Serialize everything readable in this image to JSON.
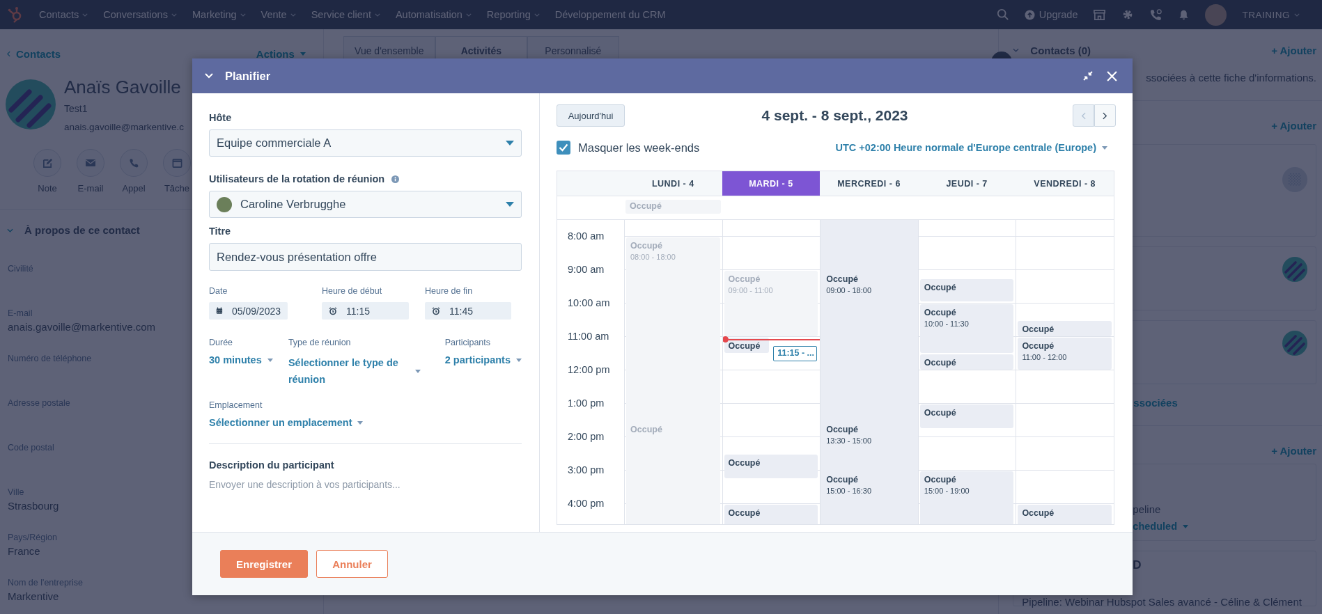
{
  "nav": {
    "items": [
      {
        "label": "Contacts",
        "has_menu": true
      },
      {
        "label": "Conversations",
        "has_menu": true
      },
      {
        "label": "Marketing",
        "has_menu": true
      },
      {
        "label": "Vente",
        "has_menu": true
      },
      {
        "label": "Service client",
        "has_menu": true
      },
      {
        "label": "Automatisation",
        "has_menu": true
      },
      {
        "label": "Reporting",
        "has_menu": true
      },
      {
        "label": "Développement du CRM",
        "has_menu": false
      }
    ],
    "upgrade": "Upgrade",
    "account": "TRAINING"
  },
  "record": {
    "back": "Contacts",
    "actions": "Actions",
    "name": "Anaïs Gavoille",
    "subtitle": "Test1",
    "email": "anais.gavoille@markentive.c",
    "quick_actions": [
      {
        "label": "Note",
        "kind": "note"
      },
      {
        "label": "E-mail",
        "kind": "email"
      },
      {
        "label": "Appel",
        "kind": "call"
      },
      {
        "label": "Tâche",
        "kind": "task"
      }
    ],
    "about": {
      "title": "À propos de ce contact",
      "expanded": true,
      "fields": [
        {
          "label": "Civilité"
        },
        {
          "label": "E-mail",
          "value": "anais.gavoille@markentive.com"
        },
        {
          "label": "Numéro de téléphone"
        },
        {
          "label": "Adresse postale"
        },
        {
          "label": "Code postal"
        },
        {
          "label": "Ville",
          "value": "Strasbourg"
        },
        {
          "label": "Pays/Région",
          "value": "France"
        },
        {
          "label": "Nom de l'entreprise",
          "value": "Markentive"
        }
      ]
    }
  },
  "center": {
    "tabs": [
      {
        "label": "Vue d'ensemble",
        "selected": false
      },
      {
        "label": "Activités",
        "selected": true
      },
      {
        "label": "Personnalisé",
        "selected": false
      }
    ]
  },
  "sidebar": {
    "sections": [
      {
        "title": "Contacts (0)",
        "expanded": true,
        "action": "+ Ajouter",
        "text": "ssociées à cette fiche d'informations."
      },
      {
        "action": "+ Ajouter",
        "cards": [
          {
            "kind": "placeholder"
          },
          {
            "kind": "avatar"
          },
          {
            "kind": "avatar"
          }
        ],
        "link": "ssociées"
      },
      {
        "action": "+ Ajouter",
        "cards": [
          {
            "kind": "text",
            "lines": [
              {
                "text": "peline",
                "kind": "plain"
              },
              {
                "text": "cheduled",
                "kind": "dropdown"
              }
            ]
          },
          {
            "kind": "text",
            "lines": [
              {
                "text": "D",
                "kind": "heading"
              },
              {
                "text": "Pipeline:  Webinar Hubspot Sales avancé - Céline & Clément",
                "kind": "full"
              }
            ]
          }
        ]
      }
    ]
  },
  "dialog": {
    "title": "Planifier",
    "expanded": true,
    "form": {
      "host": {
        "label": "Hôte",
        "value": "Equipe commerciale A"
      },
      "rotation": {
        "label": "Utilisateurs de la rotation de réunion",
        "value": "Caroline Verbrugghe"
      },
      "title": {
        "label": "Titre",
        "value": "Rendez-vous présentation offre"
      },
      "date": {
        "label": "Date",
        "value": "05/09/2023"
      },
      "start": {
        "label": "Heure de début",
        "value": "11:15"
      },
      "end": {
        "label": "Heure de fin",
        "value": "11:45"
      },
      "duration": {
        "label": "Durée",
        "value": "30 minutes"
      },
      "meeting_type": {
        "label": "Type de réunion",
        "value": "Sélectionner le type de réunion"
      },
      "participants": {
        "label": "Participants",
        "value": "2 participants"
      },
      "location": {
        "label": "Emplacement",
        "value": "Sélectionner un emplacement"
      },
      "description": {
        "label": "Description du participant",
        "placeholder": "Envoyer une description à vos participants..."
      }
    },
    "buttons": [
      {
        "label": "Enregistrer",
        "kind": "primary"
      },
      {
        "label": "Annuler",
        "kind": "secondary"
      }
    ],
    "calendar": {
      "today": "Aujourd'hui",
      "range": "4 sept. - 8 sept., 2023",
      "hide_weekends": {
        "label": "Masquer les week-ends",
        "checked": true
      },
      "timezone": "UTC +02:00 Heure normale d'Europe centrale (Europe)",
      "hours": [
        "8:00 am",
        "9:00 am",
        "10:00 am",
        "11:00 am",
        "12:00 pm",
        "1:00 pm",
        "2:00 pm",
        "3:00 pm",
        "4:00 pm"
      ],
      "draft": {
        "label": "11:15 - ..."
      },
      "days": [
        {
          "label": "LUNDI - 4",
          "selected": false,
          "shaded": false,
          "all_day": {
            "title": "Occupé",
            "past": true
          },
          "events": [
            {
              "title": "Occupé",
              "time": "08:00 - 18:00",
              "past": true
            },
            {
              "title": "Occupé",
              "past": true
            }
          ]
        },
        {
          "label": "MARDI - 5",
          "selected": true,
          "shaded": false,
          "events": [
            {
              "title": "Occupé",
              "time": "09:00 - 11:00",
              "past": true
            },
            {
              "title": "Occupé",
              "past": false
            },
            {
              "title": "Occupé",
              "past": false
            },
            {
              "title": "Occupé",
              "past": false
            }
          ]
        },
        {
          "label": "MERCREDI - 6",
          "selected": false,
          "shaded": true,
          "events": [
            {
              "title": "Occupé",
              "time": "09:00 - 18:00",
              "past": false
            },
            {
              "title": "Occupé",
              "time": "13:30 - 15:00",
              "past": false
            },
            {
              "title": "Occupé",
              "time": "15:00 - 16:30",
              "past": false
            }
          ]
        },
        {
          "label": "JEUDI - 7",
          "selected": false,
          "shaded": false,
          "events": [
            {
              "title": "Occupé",
              "past": false
            },
            {
              "title": "Occupé",
              "time": "10:00 - 11:30",
              "past": false
            },
            {
              "title": "Occupé",
              "past": false
            },
            {
              "title": "Occupé",
              "past": false
            },
            {
              "title": "Occupé",
              "time": "15:00 - 19:00",
              "past": false
            }
          ]
        },
        {
          "label": "VENDREDI - 8",
          "selected": false,
          "shaded": false,
          "events": [
            {
              "title": "Occupé",
              "past": false
            },
            {
              "title": "Occupé",
              "time": "11:00 - 12:00",
              "past": false
            },
            {
              "title": "Occupé",
              "past": false
            }
          ]
        }
      ]
    }
  }
}
